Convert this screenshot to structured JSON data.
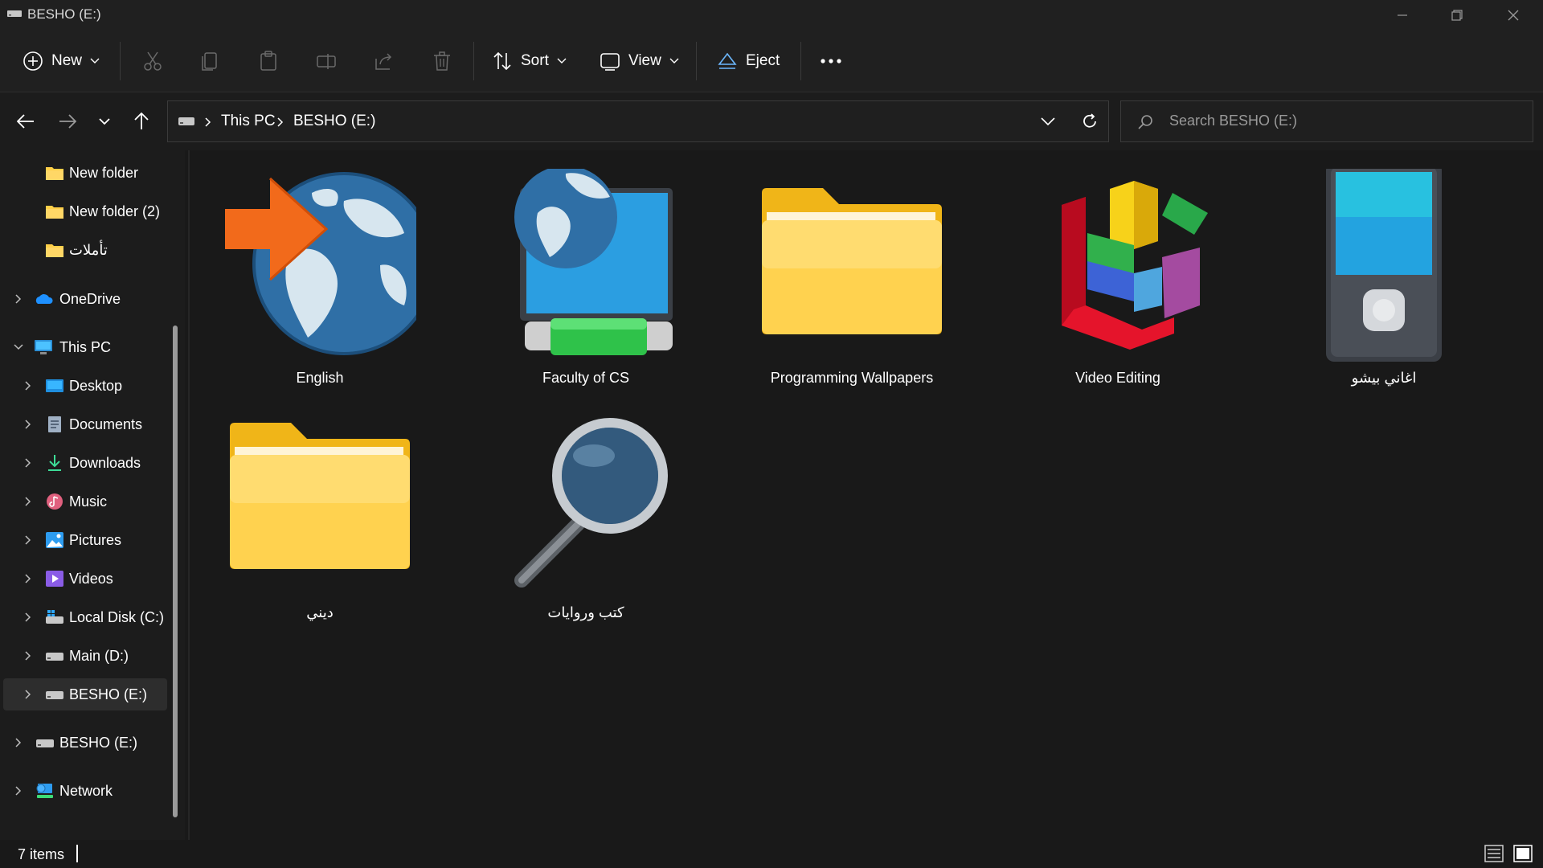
{
  "window": {
    "title": "BESHO (E:)"
  },
  "toolbar": {
    "new_label": "New",
    "sort_label": "Sort",
    "view_label": "View",
    "eject_label": "Eject"
  },
  "navigation": {
    "breadcrumbs": [
      "This PC",
      "BESHO (E:)"
    ],
    "search_placeholder": "Search BESHO (E:)"
  },
  "sidebar": {
    "items": [
      {
        "label": "New folder",
        "icon": "folder-icon"
      },
      {
        "label": "New folder (2)",
        "icon": "folder-icon"
      },
      {
        "label": "تأملات",
        "icon": "folder-icon"
      },
      {
        "label": "OneDrive",
        "icon": "onedrive-cloud-icon"
      },
      {
        "label": "This PC",
        "icon": "monitor-icon"
      },
      {
        "label": "Desktop",
        "icon": "desktop-icon"
      },
      {
        "label": "Documents",
        "icon": "documents-icon"
      },
      {
        "label": "Downloads",
        "icon": "download-arrow-icon"
      },
      {
        "label": "Music",
        "icon": "music-icon"
      },
      {
        "label": "Pictures",
        "icon": "pictures-icon"
      },
      {
        "label": "Videos",
        "icon": "videos-icon"
      },
      {
        "label": "Local Disk (C:)",
        "icon": "windows-drive-icon"
      },
      {
        "label": "Main (D:)",
        "icon": "drive-icon"
      },
      {
        "label": "BESHO (E:)",
        "icon": "drive-icon",
        "selected": true
      },
      {
        "label": "BESHO (E:)",
        "icon": "drive-icon"
      },
      {
        "label": "Network",
        "icon": "network-icon"
      }
    ]
  },
  "content": {
    "items": [
      {
        "label": "English",
        "icon": "globe-arrow-icon"
      },
      {
        "label": "Faculty of CS",
        "icon": "network-computer-icon"
      },
      {
        "label": "Programming Wallpapers",
        "icon": "folder-icon"
      },
      {
        "label": "Video Editing",
        "icon": "colored-blocks-icon"
      },
      {
        "label": "اغاني بيشو",
        "icon": "media-player-icon"
      },
      {
        "label": "ديني",
        "icon": "folder-icon"
      },
      {
        "label": "كتب وروايات",
        "icon": "magnifier-icon"
      }
    ]
  },
  "status": {
    "item_count": "7 items"
  },
  "colors": {
    "window_bg": "#191919",
    "toolbar_bg": "#202020",
    "folder_yellow": "#ffd766",
    "accent_blue": "#4cc2ff",
    "eject_blue": "#6cb8ff"
  }
}
